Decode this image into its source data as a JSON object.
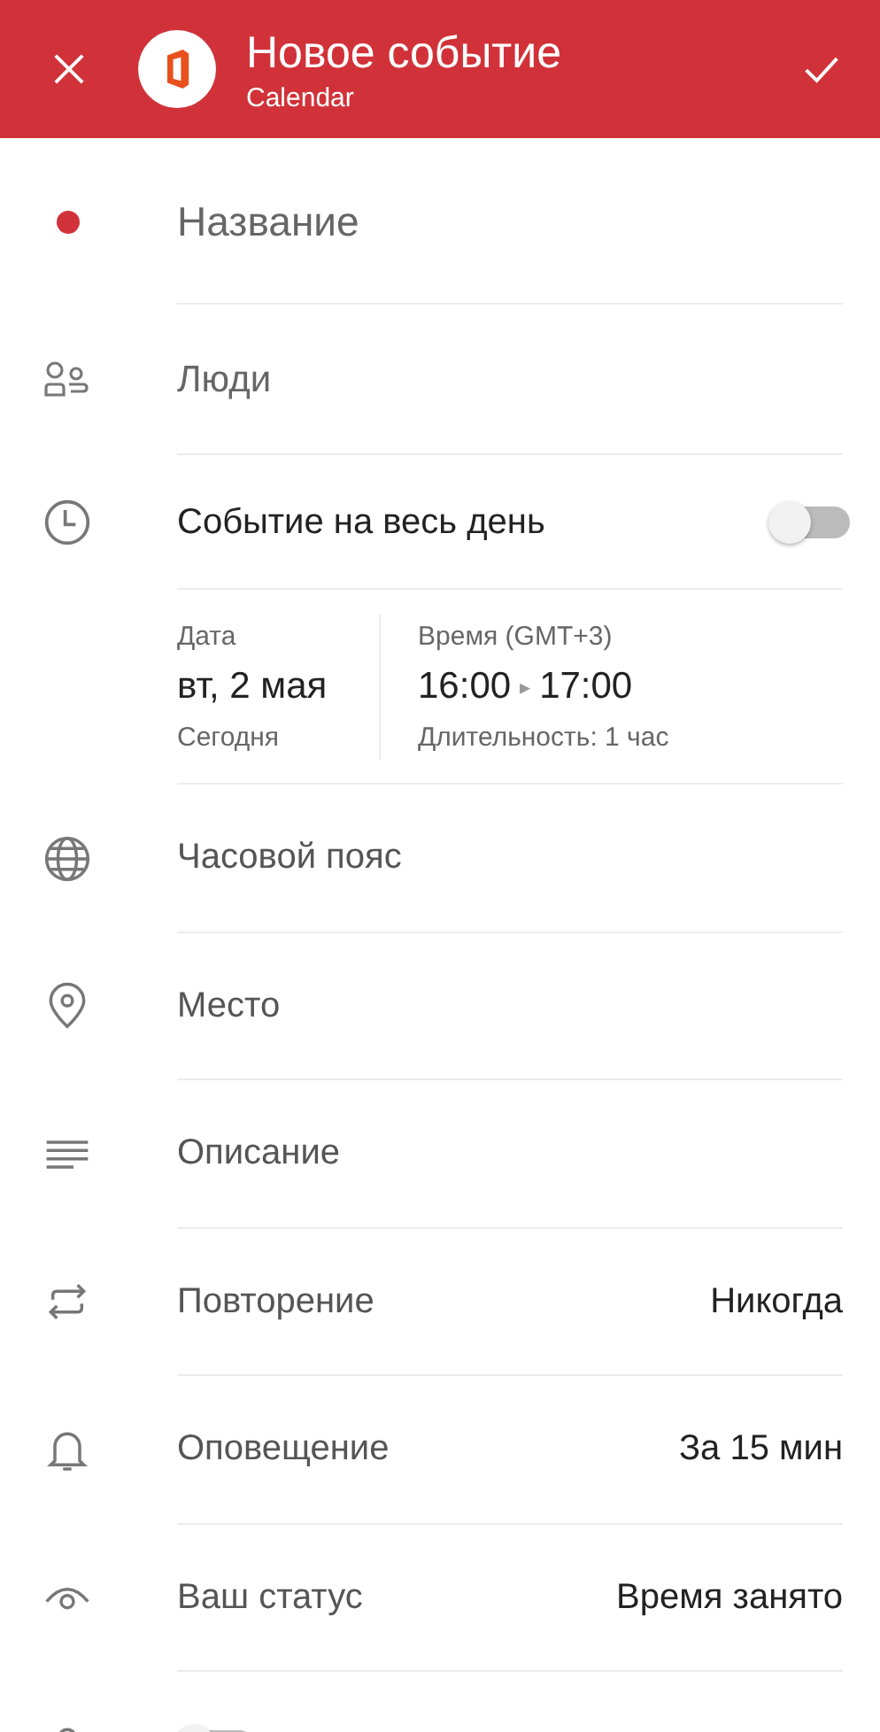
{
  "header": {
    "title": "Новое событие",
    "subtitle": "Calendar"
  },
  "title_field": {
    "placeholder": "Название",
    "color": "#d13239"
  },
  "people_field": {
    "placeholder": "Люди"
  },
  "all_day": {
    "label": "Событие на весь день",
    "on": false
  },
  "date": {
    "label": "Дата",
    "value": "вт, 2 мая",
    "note": "Сегодня"
  },
  "time": {
    "label": "Время (GMT+3)",
    "start": "16:00",
    "arrow": "▸",
    "end": "17:00",
    "note": "Длительность: 1 час"
  },
  "rows": [
    {
      "kind": "link",
      "label": "Часовой пояс"
    },
    {
      "kind": "link",
      "label": "Место"
    },
    {
      "kind": "link",
      "label": "Описание"
    },
    {
      "kind": "option",
      "label": "Повторение",
      "value": "Никогда"
    },
    {
      "kind": "option",
      "label": "Оповещение",
      "value": "За 15 мин"
    },
    {
      "kind": "option",
      "label": "Ваш статус",
      "value": "Время занято"
    },
    {
      "kind": "toggle",
      "on": false
    }
  ]
}
